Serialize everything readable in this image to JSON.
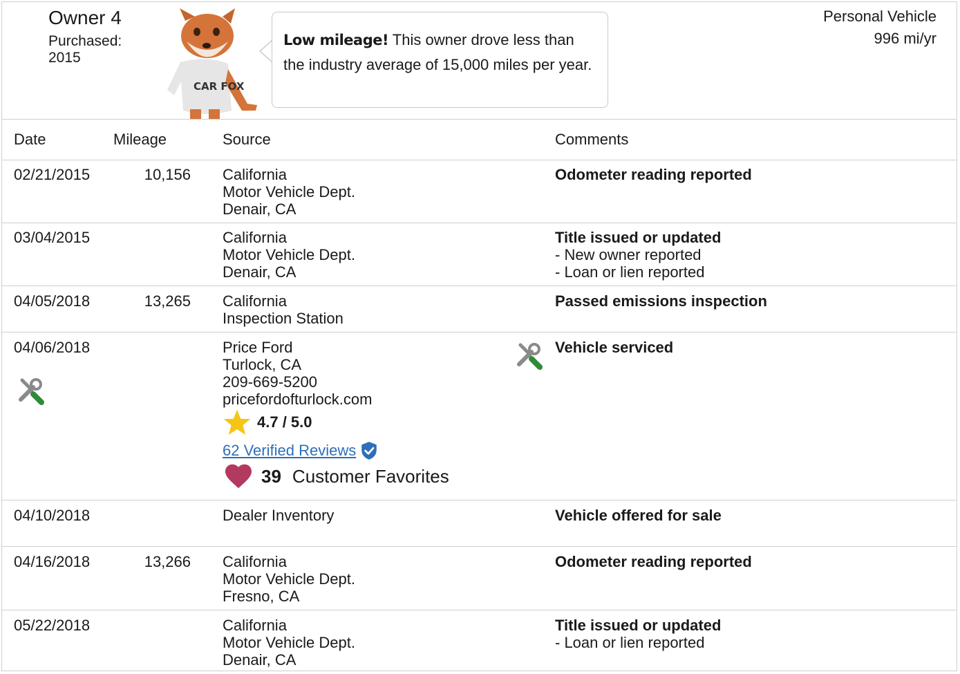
{
  "owner": {
    "title": "Owner 4",
    "purchased_label": "Purchased:",
    "purchased_year": "2015",
    "fox_shirt_text": "CAR FOX"
  },
  "callout": {
    "bold": "Low mileage!",
    "text": " This owner drove less than the industry average of 15,000 miles per year."
  },
  "vehicle": {
    "type": "Personal Vehicle",
    "miles_per_year": "996 mi/yr"
  },
  "table": {
    "headers": {
      "date": "Date",
      "mileage": "Mileage",
      "source": "Source",
      "comments": "Comments"
    },
    "rows": [
      {
        "date": "02/21/2015",
        "mileage": "10,156",
        "source": [
          "California",
          "Motor Vehicle Dept.",
          "Denair, CA"
        ],
        "comment_title": "Odometer reading reported",
        "comment_items": []
      },
      {
        "date": "03/04/2015",
        "mileage": "",
        "source": [
          "California",
          "Motor Vehicle Dept.",
          "Denair, CA"
        ],
        "comment_title": "Title issued or updated",
        "comment_items": [
          "- New owner reported",
          "- Loan or lien reported"
        ]
      },
      {
        "date": "04/05/2018",
        "mileage": "13,265",
        "source": [
          "California",
          "Inspection Station"
        ],
        "comment_title": "Passed emissions inspection",
        "comment_items": []
      },
      {
        "date": "04/06/2018",
        "mileage": "",
        "source": [
          "Price Ford",
          "Turlock, CA",
          "209-669-5200",
          "pricefordofturlock.com"
        ],
        "comment_title": "Vehicle serviced",
        "comment_items": [],
        "rating": "4.7 / 5.0",
        "reviews_link": "62 Verified Reviews",
        "favorites_count": "39",
        "favorites_label": "Customer Favorites"
      },
      {
        "date": "04/10/2018",
        "mileage": "",
        "source": [
          "Dealer Inventory"
        ],
        "comment_title": "Vehicle offered for sale",
        "comment_items": []
      },
      {
        "date": "04/16/2018",
        "mileage": "13,266",
        "source": [
          "California",
          "Motor Vehicle Dept.",
          "Fresno, CA"
        ],
        "comment_title": "Odometer reading reported",
        "comment_items": []
      },
      {
        "date": "05/22/2018",
        "mileage": "",
        "source": [
          "California",
          "Motor Vehicle Dept.",
          "Denair, CA"
        ],
        "comment_title": "Title issued or updated",
        "comment_items": [
          "- Loan or lien reported"
        ]
      }
    ]
  },
  "icons": {
    "service": "wrench-screwdriver-icon",
    "star": "star-icon",
    "verified": "verified-shield-icon",
    "heart": "heart-icon"
  },
  "colors": {
    "star": "#f5c518",
    "heart": "#b23a5f",
    "link": "#2e6fb7",
    "verified": "#2e6fb7",
    "tool_green": "#2e8b3a",
    "tool_gray": "#8a8a8a"
  }
}
